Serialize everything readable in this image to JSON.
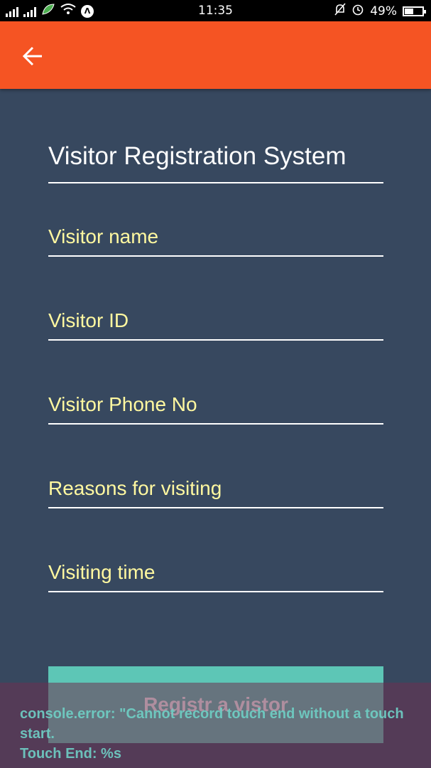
{
  "status_bar": {
    "time": "11:35",
    "battery_percent": "49%",
    "battery_level": 0.49,
    "app_badge": "Λ",
    "icons": [
      "signal-icon",
      "signal-icon",
      "leaf-icon",
      "wifi-icon",
      "app-badge-icon",
      "mute-icon",
      "alarm-icon",
      "battery-icon"
    ]
  },
  "app_bar": {
    "back_icon": "arrow-left-icon",
    "color": "#f55423"
  },
  "form": {
    "title": "Visitor Registration System",
    "fields": [
      {
        "placeholder": "Visitor name",
        "value": ""
      },
      {
        "placeholder": "Visitor ID",
        "value": ""
      },
      {
        "placeholder": "Visitor Phone No",
        "value": ""
      },
      {
        "placeholder": "Reasons for visiting",
        "value": ""
      },
      {
        "placeholder": "Visiting time",
        "value": ""
      }
    ],
    "submit_label": "Registr a vistor"
  },
  "console_overlay": {
    "text": "console.error: \"Cannot record touch end without a touch start.\nTouch End: %s"
  },
  "colors": {
    "background": "#37485f",
    "accent": "#f55423",
    "placeholder": "#fff8a0",
    "button": "#5dc6b6"
  }
}
